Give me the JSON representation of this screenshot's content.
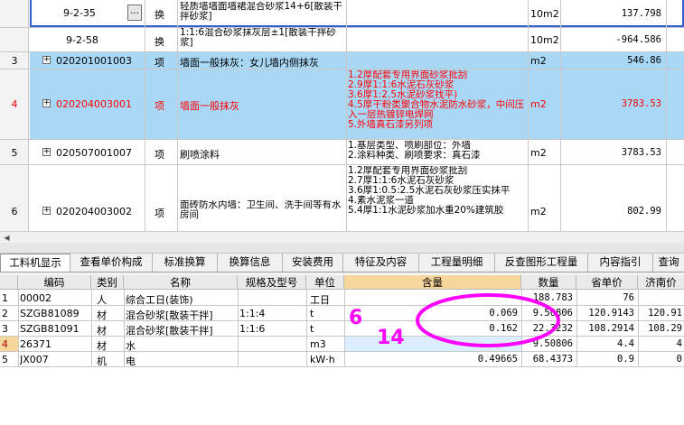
{
  "upper": {
    "sub1": {
      "code": "9-2-35",
      "btn": "…",
      "type": "换",
      "name": "轻质墙墙面墙裙混合砂浆14+6[散装干拌砂浆]",
      "unit": "10m2",
      "amount": "137.798"
    },
    "sub2": {
      "code": "9-2-58",
      "type": "换",
      "name": "1:1:6混合砂浆抹灰层±1[散装干拌砂浆]",
      "unit": "10m2",
      "amount": "-964.586"
    },
    "rows": [
      {
        "num": "3",
        "code": "020201001003",
        "type": "项",
        "name": "墙面一般抹灰：女儿墙内侧抹灰",
        "feature": [],
        "unit": "m2",
        "amount": "546.86"
      },
      {
        "num": "4",
        "code": "020204003001",
        "type": "项",
        "name": "墙面一般抹灰",
        "feature": [
          "1.2厚配套专用界面砂浆批刮",
          "2.9厚1:1:6水泥石灰砂浆",
          "3.6厚1:2.5水泥砂浆找平)",
          "4.5厚干粉类聚合物水泥防水砂浆，中间压入一层热镀锌电焊网",
          "5.外墙真石漆另列项"
        ],
        "unit": "m2",
        "amount": "3783.53"
      },
      {
        "num": "5",
        "code": "020507001007",
        "type": "项",
        "name": "刷喷涂料",
        "feature": [
          "1.基层类型、喷刷部位：外墙",
          "2.涂料种类、刷喷要求：真石漆"
        ],
        "unit": "m2",
        "amount": "3783.53"
      },
      {
        "num": "6",
        "code": "020204003002",
        "type": "项",
        "name": "面砖防水内墙：卫生间、洗手间等有水房间",
        "feature": [
          "1.2厚配套专用界面砂浆批刮",
          "2.7厚1:1:6水泥石灰砂浆",
          "3.6厚1:0.5:2.5水泥石灰砂浆压实抹平",
          "4.素水泥浆一道",
          "5.4厚1:1水泥砂浆加水重20%建筑胶"
        ],
        "unit": "m2",
        "amount": "802.99"
      }
    ]
  },
  "tabs": [
    "工料机显示",
    "查看单价构成",
    "标准换算",
    "换算信息",
    "安装费用",
    "特征及内容",
    "工程量明细",
    "反查图形工程量",
    "内容指引",
    "查询"
  ],
  "bottom": {
    "headers": [
      "编码",
      "类别",
      "名称",
      "规格及型号",
      "单位",
      "含量",
      "数量",
      "省单价",
      "济南价"
    ],
    "rows": [
      {
        "n": "1",
        "code": "00002",
        "cat": "人",
        "name": "综合工日(装饰)",
        "spec": "",
        "unit": "工日",
        "qty": "",
        "count": "188.783",
        "price": "76",
        "jn": ""
      },
      {
        "n": "2",
        "code": "SZGB81089",
        "cat": "材",
        "name": "混合砂浆[散装干拌]",
        "spec": "1:1:4",
        "unit": "t",
        "qty": "0.069",
        "count": "9.50806",
        "price": "120.9143",
        "jn": "120.91"
      },
      {
        "n": "3",
        "code": "SZGB81091",
        "cat": "材",
        "name": "混合砂浆[散装干拌]",
        "spec": "1:1:6",
        "unit": "t",
        "qty": "0.162",
        "count": "22.3232",
        "price": "108.2914",
        "jn": "108.29"
      },
      {
        "n": "4",
        "code": "26371",
        "cat": "材",
        "name": "水",
        "spec": "",
        "unit": "m3",
        "qty": "",
        "count": "9.50806",
        "price": "4.4",
        "jn": "4"
      },
      {
        "n": "5",
        "code": "JX007",
        "cat": "机",
        "name": "电",
        "spec": "",
        "unit": "kW·h",
        "qty": "0.49665",
        "count": "68.4373",
        "price": "0.9",
        "jn": "0"
      }
    ]
  },
  "annotations": {
    "a1": "6",
    "a2": "14"
  },
  "colors": {
    "selected": "#a9d8f6",
    "header": "#eaeaea",
    "highlight_red": "#ff0000",
    "annotation": "#ff00ff"
  }
}
